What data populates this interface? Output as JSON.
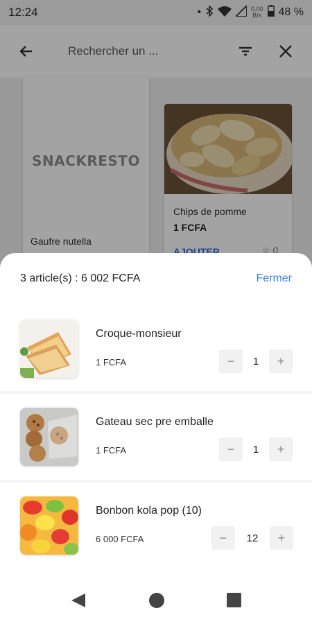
{
  "status_bar": {
    "time": "12:24",
    "dot": "•",
    "net_speed_value": "0.00",
    "net_speed_unit": "B/s",
    "battery_percent": "48 %",
    "icons": [
      "notification-dot-icon",
      "bluetooth-icon",
      "wifi-icon",
      "signal-icon",
      "battery-icon"
    ]
  },
  "search": {
    "placeholder": "Rechercher un ...",
    "icons": [
      "back-arrow-icon",
      "filter-icon",
      "close-icon"
    ]
  },
  "products": [
    {
      "name": "Gaufre nutella",
      "logo_text": "SNACKRESTO"
    },
    {
      "name": "Chips de pomme",
      "price": "1 FCFA",
      "add_label": "AJOUTER",
      "rating": "☆ 0"
    }
  ],
  "cart": {
    "summary": "3 article(s) : 6 002 FCFA",
    "close_label": "Fermer",
    "items": [
      {
        "name": "Croque-monsieur",
        "price": "1 FCFA",
        "quantity": "1"
      },
      {
        "name": "Gateau sec pre emballe",
        "price": "1 FCFA",
        "quantity": "1"
      },
      {
        "name": "Bonbon kola pop (10)",
        "price": "6 000 FCFA",
        "quantity": "12"
      }
    ],
    "minus_symbol": "−",
    "plus_symbol": "+"
  },
  "colors": {
    "accent": "#3b7fe0",
    "overlay": "#5c5c5c",
    "sheet": "#ffffff"
  },
  "nav_bar": {
    "icons": [
      "nav-back-icon",
      "nav-home-icon",
      "nav-recents-icon"
    ]
  }
}
